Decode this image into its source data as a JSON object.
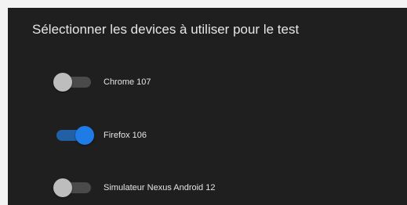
{
  "panel": {
    "title": "Sélectionner les devices à utiliser pour le test"
  },
  "devices": [
    {
      "label": "Chrome 107",
      "enabled": false
    },
    {
      "label": "Firefox 106",
      "enabled": true
    },
    {
      "label": "Simulateur Nexus Android 12",
      "enabled": false
    }
  ],
  "colors": {
    "panel_background": "#1f1f1f",
    "switch_on_thumb": "#1f7be6",
    "switch_on_track": "#2260a6",
    "switch_off_thumb": "#bdbdbd",
    "switch_off_track": "#4a4a4a"
  }
}
